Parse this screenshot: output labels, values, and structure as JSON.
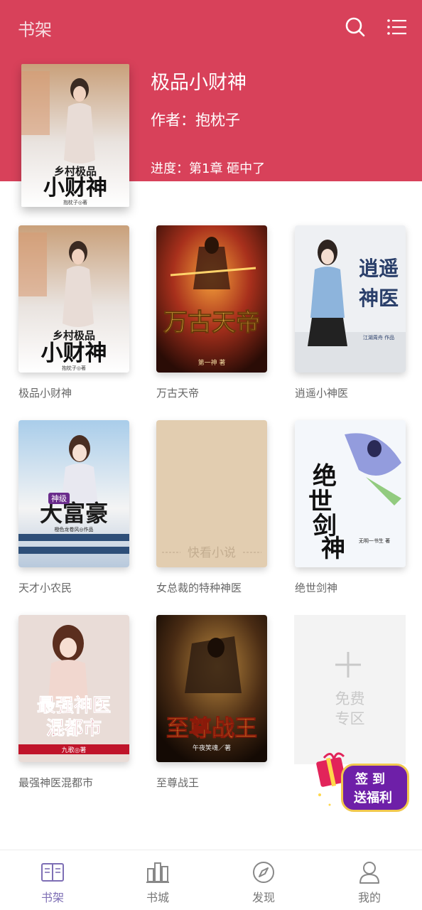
{
  "header": {
    "title": "书架",
    "featured": {
      "title": "极品小财神",
      "author": "作者：抱枕子",
      "progress": "进度：第1章 砸中了",
      "cover_text": "乡村极品小财神",
      "cover_author": "抱枕子◎著"
    }
  },
  "books": [
    {
      "name": "极品小财神",
      "cover_text": "乡村极品小财神",
      "cover_sub": "抱枕子◎著"
    },
    {
      "name": "万古天帝",
      "cover_text": "万古天帝",
      "cover_sub": "第一神 著"
    },
    {
      "name": "逍遥小神医",
      "cover_text": "逍遥神医",
      "cover_sub": "江湖周舟 作品"
    },
    {
      "name": "天才小农民",
      "cover_text": "神级大富豪",
      "cover_sub": "橙色龙卷风◎作品"
    },
    {
      "name": "女总裁的特种神医",
      "cover_text": "快看小说",
      "cover_sub": ""
    },
    {
      "name": "绝世剑神",
      "cover_text": "绝世剑神",
      "cover_sub": "无明一书生 著"
    },
    {
      "name": "最强神医混都市",
      "cover_text": "最强神医混都市",
      "cover_sub": "九歌◎著"
    },
    {
      "name": "至尊战王",
      "cover_text": "至尊战王",
      "cover_sub": "午夜笑魂／著"
    }
  ],
  "free_zone": {
    "line1": "免费",
    "line2": "专区"
  },
  "checkin": {
    "line1": "签到",
    "line2": "送福利"
  },
  "nav": [
    {
      "label": "书架",
      "icon": "bookshelf-icon",
      "active": true
    },
    {
      "label": "书城",
      "icon": "bookstore-icon",
      "active": false
    },
    {
      "label": "发现",
      "icon": "compass-icon",
      "active": false
    },
    {
      "label": "我的",
      "icon": "user-icon",
      "active": false
    }
  ],
  "colors": {
    "accent": "#d8415a",
    "nav_active": "#7e6fb5"
  }
}
